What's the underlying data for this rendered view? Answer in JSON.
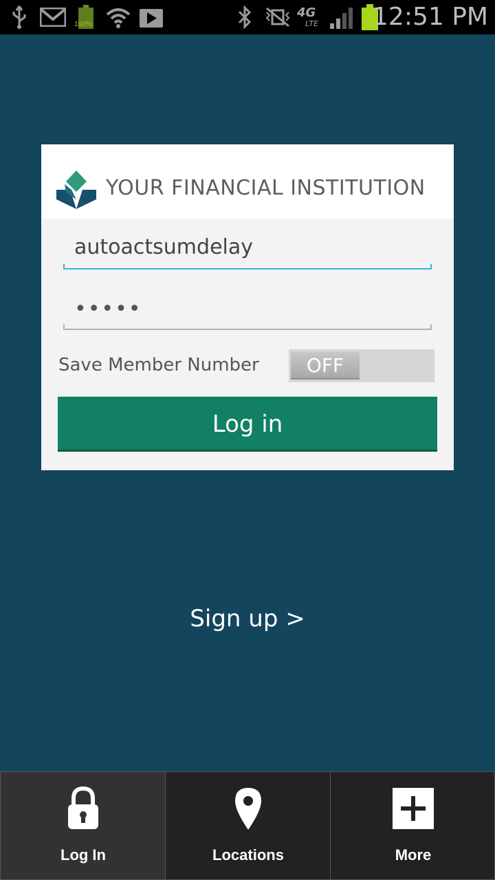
{
  "status_bar": {
    "time": "12:51 PM",
    "battery_small_label": "100%",
    "network_label": "4G",
    "network_sublabel": "LTE"
  },
  "login_card": {
    "brand_name": "YOUR FINANCIAL INSTITUTION",
    "username_value": "autoactsumdelay",
    "password_value": "•••••",
    "save_member_label": "Save Member Number",
    "toggle_value": "OFF",
    "login_button_label": "Log in"
  },
  "signup_link": "Sign up >",
  "bottom_nav": {
    "items": [
      {
        "label": "Log In",
        "icon": "lock-icon"
      },
      {
        "label": "Locations",
        "icon": "location-pin-icon"
      },
      {
        "label": "More",
        "icon": "plus-icon"
      }
    ]
  },
  "colors": {
    "background": "#13455c",
    "primary_button": "#128064",
    "input_focus": "#33b5e5",
    "nav_background": "#222222"
  }
}
